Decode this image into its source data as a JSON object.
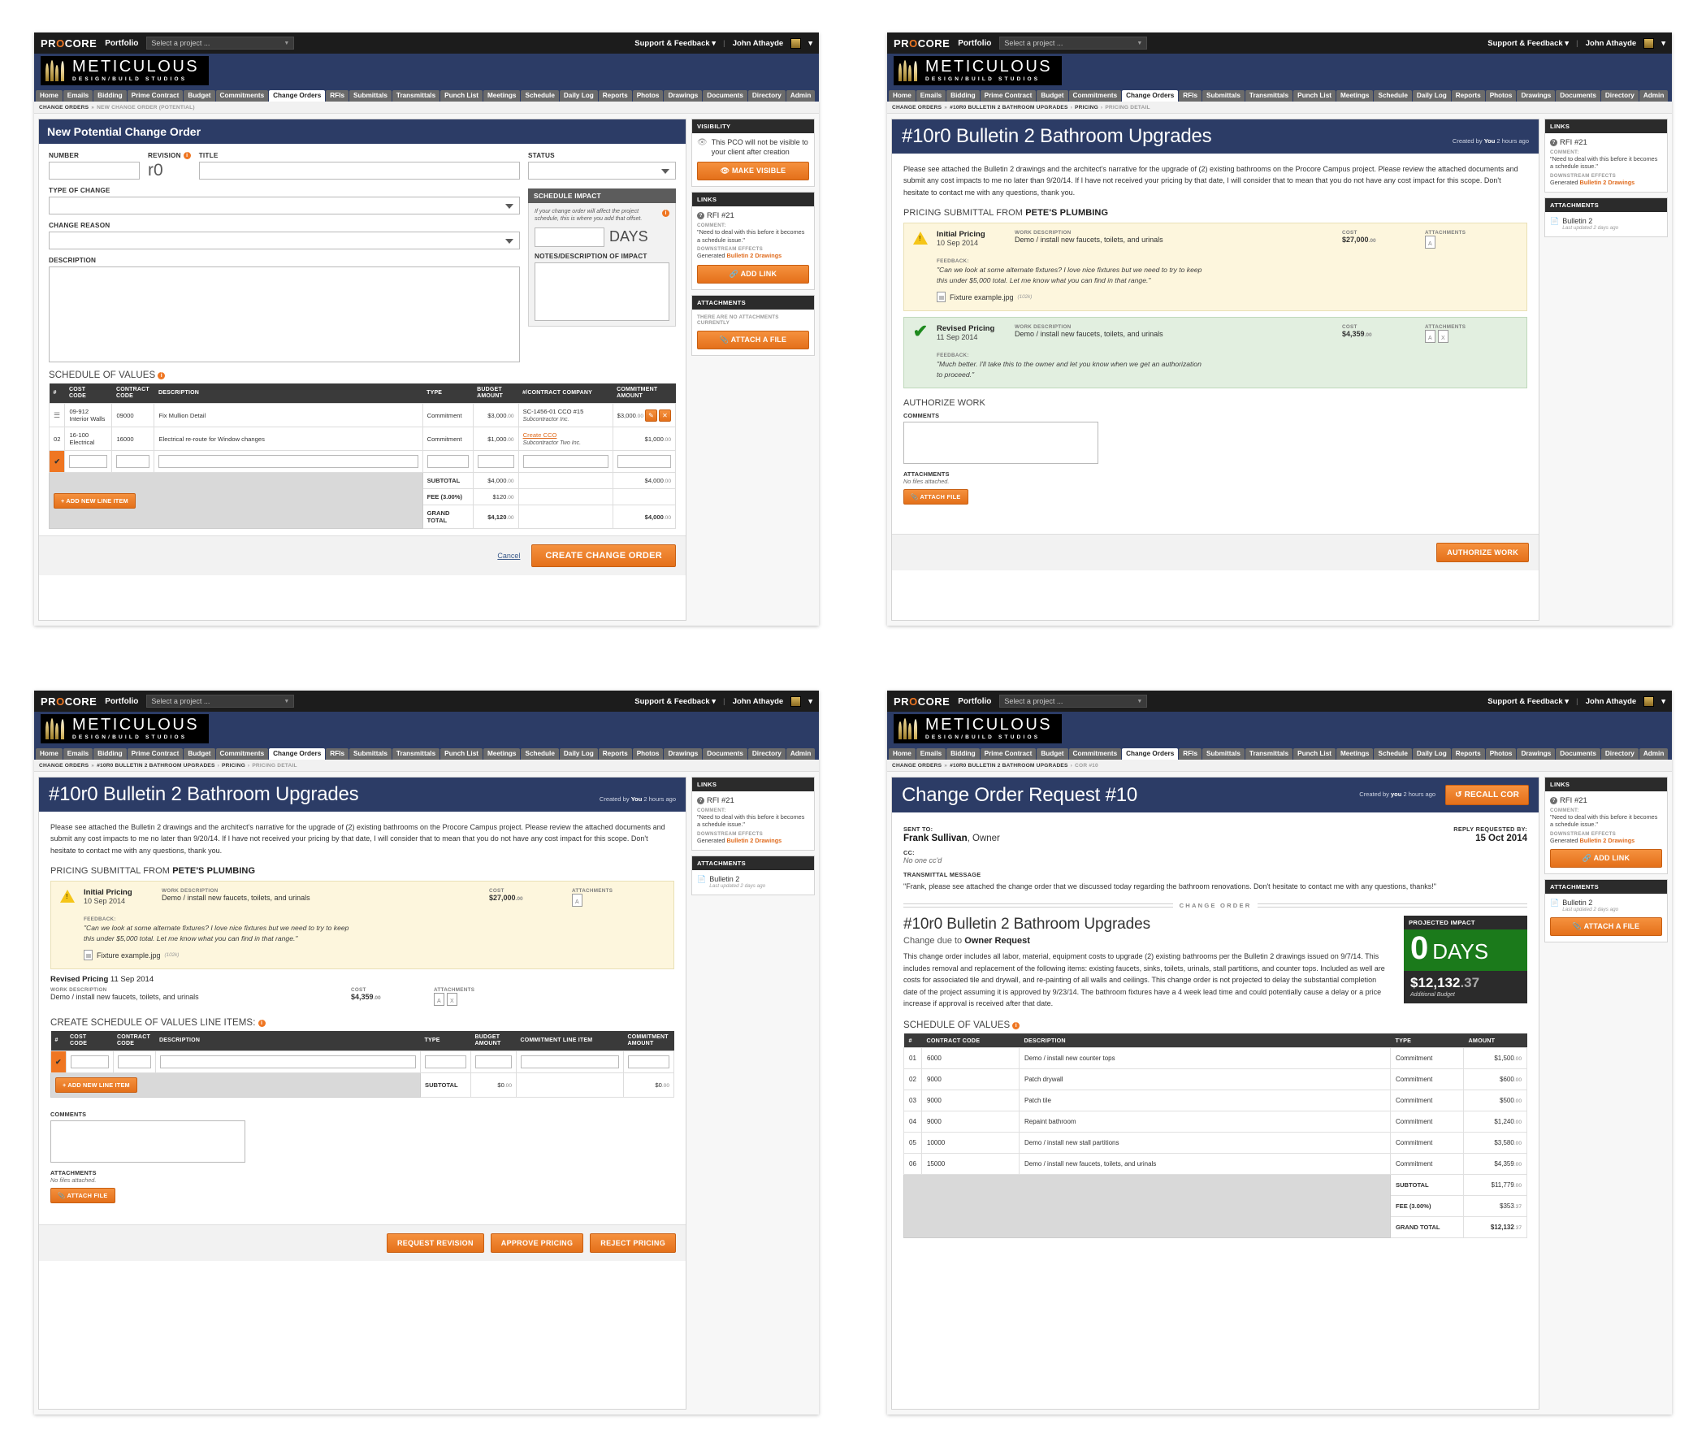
{
  "topbar": {
    "logo": "PROCORE",
    "portfolio": "Portfolio",
    "project_placeholder": "Select a project ...",
    "support": "Support & Feedback",
    "user": "John Athayde"
  },
  "brand": {
    "line1": "METICULOUS",
    "line2": "DESIGN/BUILD STUDIOS"
  },
  "tabs": [
    "Home",
    "Emails",
    "Bidding",
    "Prime Contract",
    "Budget",
    "Commitments",
    "Change Orders",
    "RFIs",
    "Submittals",
    "Transmittals",
    "Punch List",
    "Meetings",
    "Schedule",
    "Daily Log",
    "Reports",
    "Photos",
    "Drawings",
    "Documents",
    "Directory",
    "Admin"
  ],
  "active_tab": "Change Orders",
  "panel1": {
    "breadcrumb": {
      "root": "CHANGE ORDERS",
      "sep": "»",
      "current": "NEW CHANGE ORDER (POTENTIAL)"
    },
    "title": "New Potential Change Order",
    "fields": {
      "number_label": "NUMBER",
      "revision_label": "REVISION",
      "revision_value": "r0",
      "title_label": "TITLE",
      "type_label": "TYPE OF CHANGE",
      "reason_label": "CHANGE REASON",
      "description_label": "DESCRIPTION",
      "status_label": "STATUS"
    },
    "schedule_impact": {
      "header": "SCHEDULE IMPACT",
      "note": "If your change order will affect the project schedule, this is where you add that offset.",
      "days_label": "DAYS",
      "notes_label": "NOTES/DESCRIPTION OF IMPACT"
    },
    "sov": {
      "title": "SCHEDULE OF VALUES",
      "columns": [
        "#",
        "COST CODE",
        "CONTRACT CODE",
        "DESCRIPTION",
        "TYPE",
        "BUDGET AMOUNT",
        "#/CONTRACT COMPANY",
        "COMMITMENT AMOUNT"
      ],
      "rows": [
        {
          "num": "",
          "cost_code": "09-912",
          "cost_code_sub": "Interior Walls",
          "contract_code": "09000",
          "description": "Fix Mullion Detail",
          "type": "Commitment",
          "budget": "$3,000",
          "budget_cents": ".00",
          "company_line1": "SC-1456-01 CCO #15",
          "company_line2": "Subcontractor Inc.",
          "company_is_link": false,
          "commitment": "$3,000",
          "commitment_cents": ".00",
          "has_actions": true
        },
        {
          "num": "02",
          "cost_code": "16-100",
          "cost_code_sub": "Electrical",
          "contract_code": "16000",
          "description": "Electrical re-route for Window changes",
          "type": "Commitment",
          "budget": "$1,000",
          "budget_cents": ".00",
          "company_line1": "Create CCO",
          "company_line2": "Subcontractor Two Inc.",
          "company_is_link": true,
          "commitment": "$1,000",
          "commitment_cents": ".00",
          "has_actions": false
        }
      ],
      "add_line_item": "+ ADD NEW LINE ITEM",
      "totals": [
        {
          "label": "SUBTOTAL",
          "budget": "$4,000",
          "budget_cents": ".00",
          "commitment": "$4,000",
          "commitment_cents": ".00"
        },
        {
          "label": "FEE (3.00%)",
          "budget": "$120",
          "budget_cents": ".00",
          "commitment": "",
          "commitment_cents": ""
        },
        {
          "label": "GRAND TOTAL",
          "budget": "$4,120",
          "budget_cents": ".00",
          "commitment": "$4,000",
          "commitment_cents": ".00"
        }
      ]
    },
    "actions": {
      "cancel": "Cancel",
      "create": "CREATE CHANGE ORDER"
    },
    "sidebar": {
      "visibility_header": "VISIBILITY",
      "visibility_text": "This PCO will not be visible to your client after creation",
      "make_visible": "MAKE VISIBLE",
      "links_header": "LINKS",
      "link_title": "RFI #21",
      "comment_label": "COMMENT:",
      "comment_text": "\"Need to deal with this before it becomes a schedule issue.\"",
      "downstream_label": "DOWNSTREAM EFFECTS",
      "downstream_prefix": "Generated ",
      "downstream_link": "Bulletin 2 Drawings",
      "add_link": "ADD LINK",
      "attachments_header": "ATTACHMENTS",
      "no_attachments": "THERE ARE NO ATTACHMENTS CURRENTLY",
      "attach_file": "ATTACH A FILE"
    }
  },
  "panel2": {
    "breadcrumb": {
      "root": "CHANGE ORDERS",
      "mid": "#10R0 BULLETIN 2 BATHROOM UPGRADES",
      "mid2": "PRICING",
      "current": "PRICING DETAIL"
    },
    "doc_number": "#10r0",
    "doc_title": "Bulletin 2 Bathroom Upgrades",
    "created_prefix": "Created by ",
    "created_by": "You",
    "created_when": " 2 hours ago",
    "paragraph": "Please see attached the Bulletin 2 drawings and the architect's narrative for the upgrade of (2) existing bathrooms on the Procore Campus project.  Please review the attached documents and submit any cost impacts to me no later than 9/20/14.  If I have not received your pricing by that date, I will consider that to mean that you do not have any cost impact for this scope.  Don't hesitate to contact me with any questions, thank you.",
    "section_prefix": "PRICING SUBMITTAL FROM ",
    "section_bold": "PETE'S PLUMBING",
    "pricing": [
      {
        "state": "initial",
        "title": "Initial Pricing",
        "date": "10 Sep 2014",
        "work_label": "WORK DESCRIPTION",
        "work": "Demo / install new faucets, toilets, and urinals",
        "cost_label": "COST",
        "cost": "$27,000",
        "cost_cents": ".00",
        "att_label": "ATTACHMENTS",
        "feedback_label": "FEEDBACK:",
        "feedback": "\"Can we look at some alternate fixtures? I love nice fixtures but we need to try to keep this under $5,000 total. Let me know what you can find in that range.\"",
        "file_name": "Fixture example.jpg",
        "file_size": "(102k)",
        "icons": [
          "pdf"
        ]
      },
      {
        "state": "revised",
        "title": "Revised Pricing",
        "date": "11 Sep 2014",
        "work_label": "WORK DESCRIPTION",
        "work": "Demo / install new faucets, toilets, and urinals",
        "cost_label": "COST",
        "cost": "$4,359",
        "cost_cents": ".00",
        "att_label": "ATTACHMENTS",
        "feedback_label": "FEEDBACK:",
        "feedback": "\"Much better. I'll take this to the owner and let you know when we get an authorization to proceed.\"",
        "file_name": "",
        "file_size": "",
        "icons": [
          "pdf",
          "xls"
        ]
      }
    ],
    "authorize_header": "AUTHORIZE WORK",
    "comments_label": "COMMENTS",
    "attachments_label": "ATTACHMENTS",
    "no_files": "No files attached.",
    "attach_file": "ATTACH FILE",
    "authorize_btn": "AUTHORIZE WORK",
    "sidebar": {
      "links_header": "LINKS",
      "link_title": "RFI #21",
      "comment_label": "COMMENT:",
      "comment_text": "\"Need to deal with this before it becomes a schedule issue.\"",
      "downstream_label": "DOWNSTREAM EFFECTS",
      "downstream_prefix": "Generated ",
      "downstream_link": "Bulletin 2 Drawings",
      "attachments_header": "ATTACHMENTS",
      "att_name": "Bulletin 2",
      "att_sub": "Last updated 2 days ago"
    }
  },
  "panel3": {
    "breadcrumb": {
      "root": "CHANGE ORDERS",
      "mid": "#10R0 BULLETIN 2 BATHROOM UPGRADES",
      "mid2": "PRICING",
      "current": "PRICING DETAIL"
    },
    "doc_number": "#10r0",
    "doc_title": "Bulletin 2 Bathroom Upgrades",
    "created_prefix": "Created by ",
    "created_by": "You",
    "created_when": " 2 hours ago",
    "paragraph": "Please see attached the Bulletin 2 drawings and the architect's narrative for the upgrade of (2) existing bathrooms on the Procore Campus project.  Please review the attached documents and submit any cost impacts to me no later than 9/20/14.  If I have not received your pricing by that date, I will consider that to mean that you do not have any cost impact for this scope.  Don't hesitate to contact me with any questions, thank you.",
    "section_prefix": "PRICING SUBMITTAL FROM ",
    "section_bold": "PETE'S PLUMBING",
    "initial": {
      "title": "Initial Pricing",
      "date": "10 Sep 2014",
      "work_label": "WORK DESCRIPTION",
      "work": "Demo / install new faucets, toilets, and urinals",
      "cost_label": "COST",
      "cost": "$27,000",
      "cost_cents": ".00",
      "att_label": "ATTACHMENTS",
      "feedback_label": "FEEDBACK:",
      "feedback": "\"Can we look at some alternate fixtures? I love nice fixtures but we need to try to keep this under $5,000 total. Let me know what you can find in that range.\"",
      "file_name": "Fixture example.jpg",
      "file_size": "(102k)"
    },
    "revised": {
      "title": "Revised Pricing",
      "date": "11 Sep 2014",
      "work_label": "WORK DESCRIPTION",
      "work": "Demo / install new faucets, toilets, and urinals",
      "cost_label": "COST",
      "cost": "$4,359",
      "cost_cents": ".00",
      "att_label": "ATTACHMENTS"
    },
    "sov": {
      "title": "CREATE SCHEDULE OF VALUES LINE ITEMS:",
      "columns": [
        "#",
        "COST CODE",
        "CONTRACT CODE",
        "DESCRIPTION",
        "TYPE",
        "BUDGET AMOUNT",
        "COMMITMENT LINE ITEM",
        "COMMITMENT AMOUNT"
      ],
      "add_line_item": "+ ADD NEW LINE ITEM",
      "subtotal_label": "SUBTOTAL",
      "subtotal_budget": "$0",
      "subtotal_budget_cents": ".00",
      "subtotal_commitment": "$0",
      "subtotal_commitment_cents": ".00"
    },
    "comments_label": "COMMENTS",
    "attachments_label": "ATTACHMENTS",
    "no_files": "No files attached.",
    "attach_file": "ATTACH FILE",
    "buttons": [
      "REQUEST REVISION",
      "APPROVE PRICING",
      "REJECT PRICING"
    ],
    "sidebar": {
      "links_header": "LINKS",
      "link_title": "RFI #21",
      "comment_label": "COMMENT:",
      "comment_text": "\"Need to deal with this before it becomes a schedule issue.\"",
      "downstream_label": "DOWNSTREAM EFFECTS",
      "downstream_prefix": "Generated ",
      "downstream_link": "Bulletin 2 Drawings",
      "attachments_header": "ATTACHMENTS",
      "att_name": "Bulletin 2",
      "att_sub": "Last updated 2 days ago"
    }
  },
  "panel4": {
    "breadcrumb": {
      "root": "CHANGE ORDERS",
      "mid": "#10R0 BULLETIN 2 BATHROOM UPGRADES",
      "current": "COR #10"
    },
    "title": "Change Order Request #10",
    "recall_btn": "RECALL COR",
    "created_prefix": "Created by ",
    "created_by": "you",
    "created_when": " 2 hours ago",
    "sent_to_label": "SENT TO:",
    "sent_to_name": "Frank Sullivan",
    "sent_to_role": ", Owner",
    "reply_label": "REPLY REQUESTED BY:",
    "reply_date": "15 Oct 2014",
    "cc_label": "CC:",
    "cc_value": "No one cc'd",
    "transmittal_label": "TRANSMITTAL MESSAGE",
    "transmittal_message": "\"Frank, please see attached the change order that we discussed today regarding the bathroom renovations.  Don't hesitate to contact me with any questions, thanks!\"",
    "divider": "CHANGE ORDER",
    "co_number": "#10r0",
    "co_title": "Bulletin 2 Bathroom Upgrades",
    "change_due_prefix": "Change due to ",
    "change_due_bold": "Owner Request",
    "co_paragraph": "This change order includes all labor, material, equipment costs to upgrade (2) existing bathrooms per the Bulletin 2 drawings issued on 9/7/14.  This includes removal and replacement of the following items:  existing faucets, sinks, toilets, urinals, stall partitions, and counter tops. Included as well are costs for associated tile and drywall, and re-painting of all walls and ceilings.  This change order is not projected to delay the substantial completion date of the project assuming it is approved by 9/23/14.  The bathroom fixtures have a 4 week lead time and could potentially cause a delay or a price increase if approval is received after that date.",
    "impact": {
      "header": "PROJECTED IMPACT",
      "days_num": "0",
      "days_label": "DAYS",
      "amount": "$12,132",
      "amount_cents": ".37",
      "caption": "Additional Budget"
    },
    "sov": {
      "title": "SCHEDULE OF VALUES",
      "columns": [
        "#",
        "CONTRACT CODE",
        "DESCRIPTION",
        "TYPE",
        "AMOUNT"
      ],
      "rows": [
        {
          "num": "01",
          "contract_code": "6000",
          "description": "Demo / install new counter tops",
          "type": "Commitment",
          "amount": "$1,500",
          "cents": ".00"
        },
        {
          "num": "02",
          "contract_code": "9000",
          "description": "Patch drywall",
          "type": "Commitment",
          "amount": "$600",
          "cents": ".00"
        },
        {
          "num": "03",
          "contract_code": "9000",
          "description": "Patch tile",
          "type": "Commitment",
          "amount": "$500",
          "cents": ".00"
        },
        {
          "num": "04",
          "contract_code": "9000",
          "description": "Repaint bathroom",
          "type": "Commitment",
          "amount": "$1,240",
          "cents": ".00"
        },
        {
          "num": "05",
          "contract_code": "10000",
          "description": "Demo / install new stall partitions",
          "type": "Commitment",
          "amount": "$3,580",
          "cents": ".00"
        },
        {
          "num": "06",
          "contract_code": "15000",
          "description": "Demo / install new faucets, toilets, and urinals",
          "type": "Commitment",
          "amount": "$4,359",
          "cents": ".00"
        }
      ],
      "totals": [
        {
          "label": "SUBTOTAL",
          "amount": "$11,779",
          "cents": ".00"
        },
        {
          "label": "FEE (3.00%)",
          "amount": "$353",
          "cents": ".37"
        },
        {
          "label": "GRAND TOTAL",
          "amount": "$12,132",
          "cents": ".37"
        }
      ]
    },
    "sidebar": {
      "links_header": "LINKS",
      "link_title": "RFI #21",
      "comment_label": "COMMENT:",
      "comment_text": "\"Need to deal with this before it becomes a schedule issue.\"",
      "downstream_label": "DOWNSTREAM EFFECTS",
      "downstream_prefix": "Generated ",
      "downstream_link": "Bulletin 2 Drawings",
      "add_link": "ADD LINK",
      "attachments_header": "ATTACHMENTS",
      "att_name": "Bulletin 2",
      "att_sub": "Last updated 2 days ago",
      "attach_file": "ATTACH A FILE"
    }
  }
}
